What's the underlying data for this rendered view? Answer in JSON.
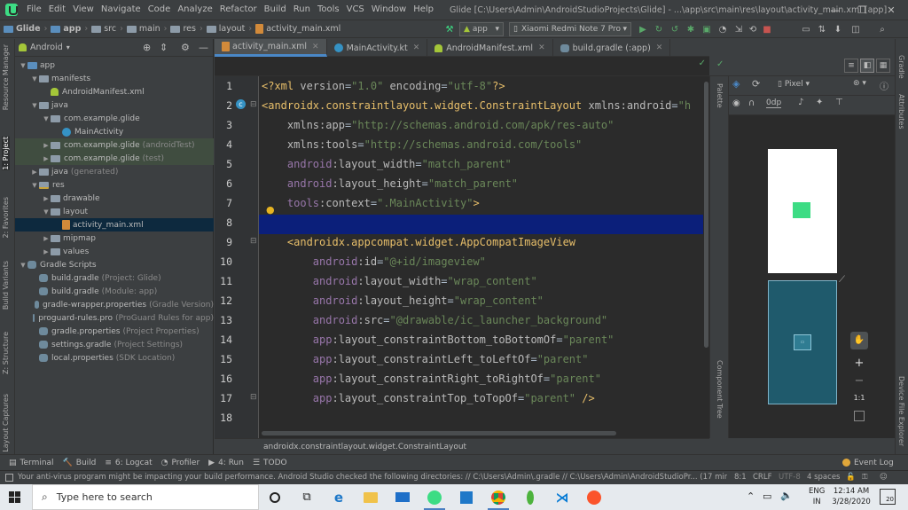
{
  "window": {
    "menu": [
      "File",
      "Edit",
      "View",
      "Navigate",
      "Code",
      "Analyze",
      "Refactor",
      "Build",
      "Run",
      "Tools",
      "VCS",
      "Window",
      "Help"
    ],
    "title": "Glide [C:\\Users\\Admin\\AndroidStudioProjects\\Glide] - ...\\app\\src\\main\\res\\layout\\activity_main.xml [app]",
    "minimize": "—",
    "restore": "❐",
    "close": "✕"
  },
  "navbar": {
    "crumbs": [
      "Glide",
      "app",
      "src",
      "main",
      "res",
      "layout",
      "activity_main.xml"
    ],
    "run_config": "app",
    "device": "Xiaomi Redmi Note 7 Pro"
  },
  "left_strip": {
    "tabs": [
      "Resource Manager",
      "1: Project",
      "2: Favorites",
      "Build Variants",
      "Z: Structure",
      "Layout Captures"
    ]
  },
  "right_strip": {
    "tabs": [
      "Gradle",
      "Attributes",
      "Device File Explorer"
    ]
  },
  "project": {
    "view_selector": "Android",
    "tree": [
      {
        "label": "app",
        "dim": "",
        "indent": 0,
        "arrow": "▼",
        "icon": "folder-blue"
      },
      {
        "label": "manifests",
        "dim": "",
        "indent": 1,
        "arrow": "▼",
        "icon": "folder"
      },
      {
        "label": "AndroidManifest.xml",
        "dim": "",
        "indent": 2,
        "arrow": "",
        "icon": "android"
      },
      {
        "label": "java",
        "dim": "",
        "indent": 1,
        "arrow": "▼",
        "icon": "folder"
      },
      {
        "label": "com.example.glide",
        "dim": "",
        "indent": 2,
        "arrow": "▼",
        "icon": "pkg"
      },
      {
        "label": "MainActivity",
        "dim": "",
        "indent": 3,
        "arrow": "",
        "icon": "class"
      },
      {
        "label": "com.example.glide",
        "dim": "(androidTest)",
        "indent": 2,
        "arrow": "▶",
        "icon": "pkg",
        "hl": true
      },
      {
        "label": "com.example.glide",
        "dim": "(test)",
        "indent": 2,
        "arrow": "▶",
        "icon": "pkg",
        "hl": true
      },
      {
        "label": "java",
        "dim": "(generated)",
        "indent": 1,
        "arrow": "▶",
        "icon": "folder"
      },
      {
        "label": "res",
        "dim": "",
        "indent": 1,
        "arrow": "▼",
        "icon": "res"
      },
      {
        "label": "drawable",
        "dim": "",
        "indent": 2,
        "arrow": "▶",
        "icon": "folder"
      },
      {
        "label": "layout",
        "dim": "",
        "indent": 2,
        "arrow": "▼",
        "icon": "folder"
      },
      {
        "label": "activity_main.xml",
        "dim": "",
        "indent": 3,
        "arrow": "",
        "icon": "xml",
        "sel": true
      },
      {
        "label": "mipmap",
        "dim": "",
        "indent": 2,
        "arrow": "▶",
        "icon": "folder"
      },
      {
        "label": "values",
        "dim": "",
        "indent": 2,
        "arrow": "▶",
        "icon": "folder"
      },
      {
        "label": "Gradle Scripts",
        "dim": "",
        "indent": 0,
        "arrow": "▼",
        "icon": "gradle"
      },
      {
        "label": "build.gradle",
        "dim": "(Project: Glide)",
        "indent": 1,
        "arrow": "",
        "icon": "gradle"
      },
      {
        "label": "build.gradle",
        "dim": "(Module: app)",
        "indent": 1,
        "arrow": "",
        "icon": "gradle"
      },
      {
        "label": "gradle-wrapper.properties",
        "dim": "(Gradle Version)",
        "indent": 1,
        "arrow": "",
        "icon": "gradle"
      },
      {
        "label": "proguard-rules.pro",
        "dim": "(ProGuard Rules for app)",
        "indent": 1,
        "arrow": "",
        "icon": "gradle"
      },
      {
        "label": "gradle.properties",
        "dim": "(Project Properties)",
        "indent": 1,
        "arrow": "",
        "icon": "gradle"
      },
      {
        "label": "settings.gradle",
        "dim": "(Project Settings)",
        "indent": 1,
        "arrow": "",
        "icon": "gradle"
      },
      {
        "label": "local.properties",
        "dim": "(SDK Location)",
        "indent": 1,
        "arrow": "",
        "icon": "gradle"
      }
    ]
  },
  "editor_tabs": [
    {
      "label": "activity_main.xml",
      "active": true
    },
    {
      "label": "MainActivity.kt",
      "active": false
    },
    {
      "label": "AndroidManifest.xml",
      "active": false
    },
    {
      "label": "build.gradle (:app)",
      "active": false
    }
  ],
  "editor": {
    "lines": [
      {
        "n": "1",
        "parts": [
          [
            "tag",
            "<?xml "
          ],
          [
            "attr",
            "version"
          ],
          [
            "plain",
            "="
          ],
          [
            "val",
            "\"1.0\""
          ],
          [
            "attr",
            " encoding"
          ],
          [
            "plain",
            "="
          ],
          [
            "val",
            "\"utf-8\""
          ],
          [
            "tag",
            "?>"
          ]
        ]
      },
      {
        "n": "2",
        "parts": [
          [
            "tag",
            "<androidx.constraintlayout.widget.ConstraintLayout "
          ],
          [
            "attr",
            "xmlns:android"
          ],
          [
            "plain",
            "="
          ],
          [
            "val",
            "\"h"
          ]
        ]
      },
      {
        "n": "3",
        "parts": [
          [
            "plain",
            "    "
          ],
          [
            "attr",
            "xmlns:app"
          ],
          [
            "plain",
            "="
          ],
          [
            "val",
            "\"http://schemas.android.com/apk/res-auto\""
          ]
        ]
      },
      {
        "n": "4",
        "parts": [
          [
            "plain",
            "    "
          ],
          [
            "attr",
            "xmlns:tools"
          ],
          [
            "plain",
            "="
          ],
          [
            "val",
            "\"http://schemas.android.com/tools\""
          ]
        ]
      },
      {
        "n": "5",
        "parts": [
          [
            "plain",
            "    "
          ],
          [
            "attrns",
            "android"
          ],
          [
            "attr",
            ":layout_width"
          ],
          [
            "plain",
            "="
          ],
          [
            "val",
            "\"match_parent\""
          ]
        ]
      },
      {
        "n": "6",
        "parts": [
          [
            "plain",
            "    "
          ],
          [
            "attrns",
            "android"
          ],
          [
            "attr",
            ":layout_height"
          ],
          [
            "plain",
            "="
          ],
          [
            "val",
            "\"match_parent\""
          ]
        ]
      },
      {
        "n": "7",
        "parts": [
          [
            "plain",
            "    "
          ],
          [
            "attrns",
            "tools"
          ],
          [
            "attr",
            ":context"
          ],
          [
            "plain",
            "="
          ],
          [
            "val",
            "\".MainActivity\""
          ],
          [
            "tag",
            ">"
          ]
        ]
      },
      {
        "n": "8",
        "parts": []
      },
      {
        "n": "9",
        "parts": [
          [
            "plain",
            "    "
          ],
          [
            "tag",
            "<androidx.appcompat.widget.AppCompatImageView"
          ]
        ]
      },
      {
        "n": "10",
        "parts": [
          [
            "plain",
            "        "
          ],
          [
            "attrns",
            "android"
          ],
          [
            "attr",
            ":id"
          ],
          [
            "plain",
            "="
          ],
          [
            "val",
            "\"@+id/imageview\""
          ]
        ]
      },
      {
        "n": "11",
        "parts": [
          [
            "plain",
            "        "
          ],
          [
            "attrns",
            "android"
          ],
          [
            "attr",
            ":layout_width"
          ],
          [
            "plain",
            "="
          ],
          [
            "val",
            "\"wrap_content\""
          ]
        ]
      },
      {
        "n": "12",
        "parts": [
          [
            "plain",
            "        "
          ],
          [
            "attrns",
            "android"
          ],
          [
            "attr",
            ":layout_height"
          ],
          [
            "plain",
            "="
          ],
          [
            "val",
            "\"wrap_content\""
          ]
        ]
      },
      {
        "n": "13",
        "parts": [
          [
            "plain",
            "        "
          ],
          [
            "attrns",
            "android"
          ],
          [
            "attr",
            ":src"
          ],
          [
            "plain",
            "="
          ],
          [
            "val",
            "\"@drawable/ic_launcher_background\""
          ]
        ]
      },
      {
        "n": "14",
        "parts": [
          [
            "plain",
            "        "
          ],
          [
            "attrns",
            "app"
          ],
          [
            "attr",
            ":layout_constraintBottom_toBottomOf"
          ],
          [
            "plain",
            "="
          ],
          [
            "val",
            "\"parent\""
          ]
        ]
      },
      {
        "n": "15",
        "parts": [
          [
            "plain",
            "        "
          ],
          [
            "attrns",
            "app"
          ],
          [
            "attr",
            ":layout_constraintLeft_toLeftOf"
          ],
          [
            "plain",
            "="
          ],
          [
            "val",
            "\"parent\""
          ]
        ]
      },
      {
        "n": "16",
        "parts": [
          [
            "plain",
            "        "
          ],
          [
            "attrns",
            "app"
          ],
          [
            "attr",
            ":layout_constraintRight_toRightOf"
          ],
          [
            "plain",
            "="
          ],
          [
            "val",
            "\"parent\""
          ]
        ]
      },
      {
        "n": "17",
        "parts": [
          [
            "plain",
            "        "
          ],
          [
            "attrns",
            "app"
          ],
          [
            "attr",
            ":layout_constraintTop_toTopOf"
          ],
          [
            "plain",
            "="
          ],
          [
            "val",
            "\"parent\""
          ],
          [
            "tag",
            " />"
          ]
        ]
      },
      {
        "n": "18",
        "parts": []
      }
    ],
    "breadcrumb": "androidx.constraintlayout.widget.ConstraintLayout"
  },
  "design": {
    "device": "Pixel",
    "margin": "0dp",
    "palette_tab": "Palette",
    "component_tree_tab": "Component Tree",
    "zoom_fit": "1:1"
  },
  "bottom_tabs": [
    {
      "icon": "▤",
      "label": "Terminal"
    },
    {
      "icon": "🔨",
      "label": "Build"
    },
    {
      "icon": "≡",
      "label": "6: Logcat"
    },
    {
      "icon": "◔",
      "label": "Profiler"
    },
    {
      "icon": "▶",
      "label": "4: Run"
    },
    {
      "icon": "☰",
      "label": "TODO"
    }
  ],
  "event_log": "Event Log",
  "status": {
    "message": "Your anti-virus program might be impacting your build performance. Android Studio checked the following directories: // C:\\Users\\Admin\\.gradle // C:\\Users\\Admin\\AndroidStudioPr... (17 minutes ago)",
    "position": "8:1",
    "line_sep": "CRLF",
    "encoding": "UTF-8",
    "indent": "4 spaces"
  },
  "taskbar": {
    "search_placeholder": "Type here to search",
    "lang_top": "ENG",
    "lang_bottom": "IN",
    "time": "12:14 AM",
    "date": "3/28/2020",
    "notif_count": "20"
  },
  "colors": {
    "accent": "#4a88c7",
    "selection": "#0b1f7a",
    "green": "#3ddc84",
    "blueprint": "#1f5a6c"
  }
}
